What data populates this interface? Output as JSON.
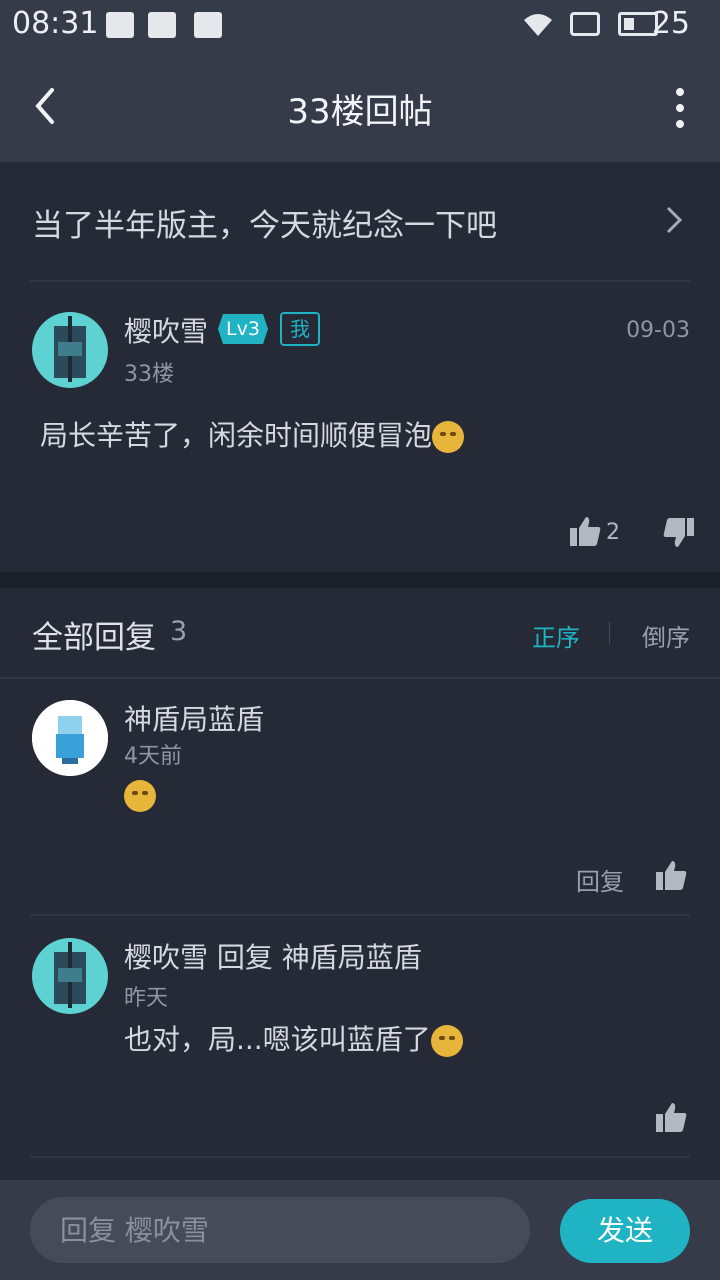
{
  "status_bar": {
    "time": "08:31",
    "battery": "25"
  },
  "header": {
    "title": "33楼回帖"
  },
  "thread": {
    "title": "当了半年版主，今天就纪念一下吧"
  },
  "post": {
    "author": "樱吹雪",
    "level_badge": "Lv3",
    "me_badge": "我",
    "floor": "33楼",
    "date": "09-03",
    "content": "局长辛苦了，闲余时间顺便冒泡",
    "like_count": "2"
  },
  "replies": {
    "title": "全部回复",
    "count": "3",
    "sort_asc": "正序",
    "sort_desc": "倒序",
    "items": [
      {
        "author": "神盾局蓝盾",
        "time": "4天前",
        "content": "",
        "reply_label": "回复"
      },
      {
        "author": "樱吹雪 回复 神盾局蓝盾",
        "time": "昨天",
        "content": "也对，局...嗯该叫蓝盾了"
      }
    ]
  },
  "composer": {
    "placeholder": "回复 樱吹雪",
    "send_label": "发送"
  },
  "colors": {
    "accent": "#1fb3c4",
    "background": "#252a36",
    "bar": "#353b48"
  }
}
